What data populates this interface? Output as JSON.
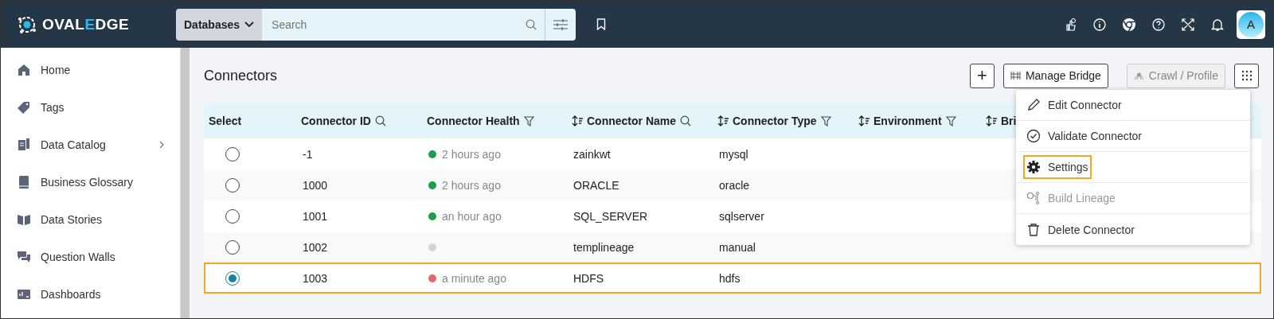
{
  "topbar": {
    "logo": {
      "prefix": "OVAL",
      "accent": "E",
      "suffix": "DGE"
    },
    "search": {
      "scope": "Databases",
      "placeholder": "Search"
    },
    "avatar": "A"
  },
  "sidebar": {
    "items": [
      {
        "label": "Home",
        "kind": "home",
        "expandable": false
      },
      {
        "label": "Tags",
        "kind": "tag",
        "expandable": false
      },
      {
        "label": "Data Catalog",
        "kind": "catalog",
        "expandable": true
      },
      {
        "label": "Business Glossary",
        "kind": "book",
        "expandable": false
      },
      {
        "label": "Data Stories",
        "kind": "stories",
        "expandable": false
      },
      {
        "label": "Question Walls",
        "kind": "chat",
        "expandable": false
      },
      {
        "label": "Dashboards",
        "kind": "dash",
        "expandable": false
      }
    ]
  },
  "page": {
    "title": "Connectors",
    "buttons": [
      {
        "kind": "add",
        "label": "+",
        "disabled": false
      },
      {
        "kind": "bridge",
        "label": "Manage Bridge",
        "disabled": false
      },
      {
        "kind": "crawl",
        "label": "Crawl / Profile",
        "disabled": true
      },
      {
        "kind": "more",
        "disabled": false
      }
    ]
  },
  "table": {
    "columns": [
      {
        "label": "Select",
        "sortable": false,
        "kind": "plain"
      },
      {
        "label": "Connector ID",
        "sortable": false,
        "kind": "search"
      },
      {
        "label": "Connector Health",
        "sortable": false,
        "kind": "filter"
      },
      {
        "label": "Connector Name",
        "sortable": true,
        "kind": "search"
      },
      {
        "label": "Connector Type",
        "sortable": true,
        "kind": "filter"
      },
      {
        "label": "Environment",
        "sortable": true,
        "kind": "filter"
      },
      {
        "label": "Bri",
        "sortable": true,
        "kind": "plain"
      }
    ],
    "rows": [
      {
        "selected": false,
        "highlighted": false,
        "id": "-1",
        "health": "2 hours ago",
        "color": "#1e9e4a",
        "name": "zainkwt",
        "type": "mysql"
      },
      {
        "selected": false,
        "highlighted": false,
        "id": "1000",
        "health": "2 hours ago",
        "color": "#1e9e4a",
        "name": "ORACLE",
        "type": "oracle"
      },
      {
        "selected": false,
        "highlighted": false,
        "id": "1001",
        "health": "an hour ago",
        "color": "#1e9e4a",
        "name": "SQL_SERVER",
        "type": "sqlserver"
      },
      {
        "selected": false,
        "highlighted": false,
        "id": "1002",
        "color": "#d4d4d4",
        "name": "templineage",
        "type": "manual"
      },
      {
        "selected": true,
        "highlighted": true,
        "id": "1003",
        "health": "a minute ago",
        "color": "#e46a6a",
        "name": "HDFS",
        "type": "hdfs"
      }
    ]
  },
  "menu": {
    "items": [
      {
        "label": "Edit Connector",
        "kind": "pencil",
        "disabled": false,
        "highlighted": false
      },
      {
        "label": "Validate Connector",
        "kind": "check",
        "disabled": false,
        "highlighted": false
      },
      {
        "label": "Settings",
        "kind": "gear",
        "disabled": false,
        "highlighted": true
      },
      {
        "label": "Build Lineage",
        "kind": "lineage",
        "disabled": true,
        "highlighted": false
      },
      {
        "label": "Delete Connector",
        "kind": "trash",
        "disabled": false,
        "highlighted": false
      }
    ]
  }
}
